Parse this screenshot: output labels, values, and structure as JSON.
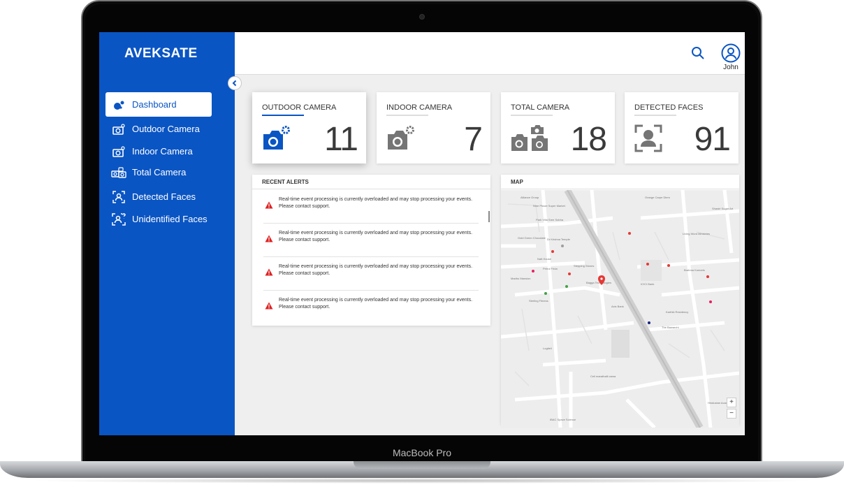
{
  "device": {
    "label": "MacBook Pro"
  },
  "app": {
    "logo": "AVEKSATE"
  },
  "sidebar": {
    "items": [
      {
        "label": "Dashboard",
        "icon": "dashboard-icon",
        "active": true
      },
      {
        "label": "Outdoor Camera",
        "icon": "camera-icon"
      },
      {
        "label": "Indoor Camera",
        "icon": "camera-icon"
      },
      {
        "label": "Total Camera",
        "icon": "cameras-icon"
      },
      {
        "label": "Detected Faces",
        "icon": "face-scan-icon"
      },
      {
        "label": "Unidentified Faces",
        "icon": "face-unknown-icon"
      }
    ]
  },
  "header": {
    "user_name": "John",
    "search_icon": "search-icon",
    "user_icon": "user-circle-icon"
  },
  "cards": [
    {
      "title": "OUTDOOR CAMERA",
      "value": "11",
      "color": "#0a55c4"
    },
    {
      "title": "INDOOR CAMERA",
      "value": "7",
      "color": "#757575"
    },
    {
      "title": "TOTAL CAMERA",
      "value": "18",
      "color": "#757575"
    },
    {
      "title": "DETECTED FACES",
      "value": "91",
      "color": "#757575"
    }
  ],
  "alerts": {
    "title": "RECENT ALERTS",
    "items": [
      {
        "line1": "Real-time event processing is currently overloaded and may stop processing your events.",
        "line2": "Please contact support."
      },
      {
        "line1": "Real-time event processing is currently overloaded and may stop processing your events.",
        "line2": "Please contact support."
      },
      {
        "line1": "Real-time event processing is currently overloaded and may stop processing your events.",
        "line2": "Please contact support."
      },
      {
        "line1": "Real-time event processing is currently overloaded and may stop processing your events.",
        "line2": "Please contact support."
      }
    ]
  },
  "map": {
    "title": "MAP",
    "zoom_in": "+",
    "zoom_out": "−",
    "places": [
      "Alliance Group",
      "Nine Phaze Super Market",
      "Park Villa Sree Sobha",
      "Dr Krishna Temple",
      "Gold Green Chocolate",
      "Natt House",
      "Petrol Frida",
      "Stepping Stones",
      "Madhu Mansion",
      "Bagga Technologies",
      "Sterling Fitness",
      "Axis Bank",
      "ICICI Bank",
      "Karthik Residency",
      "The Bawarchi",
      "Logiteli",
      "Ceil marathalli cama",
      "IBAC Space Science",
      "Orange Carpe Diem",
      "Shastri Sugar Art",
      "Living Word Ministries",
      "Brahma Kumaris",
      "Hindustan Academy"
    ]
  },
  "colors": {
    "brand": "#0a55c4",
    "alert": "#e02020"
  }
}
